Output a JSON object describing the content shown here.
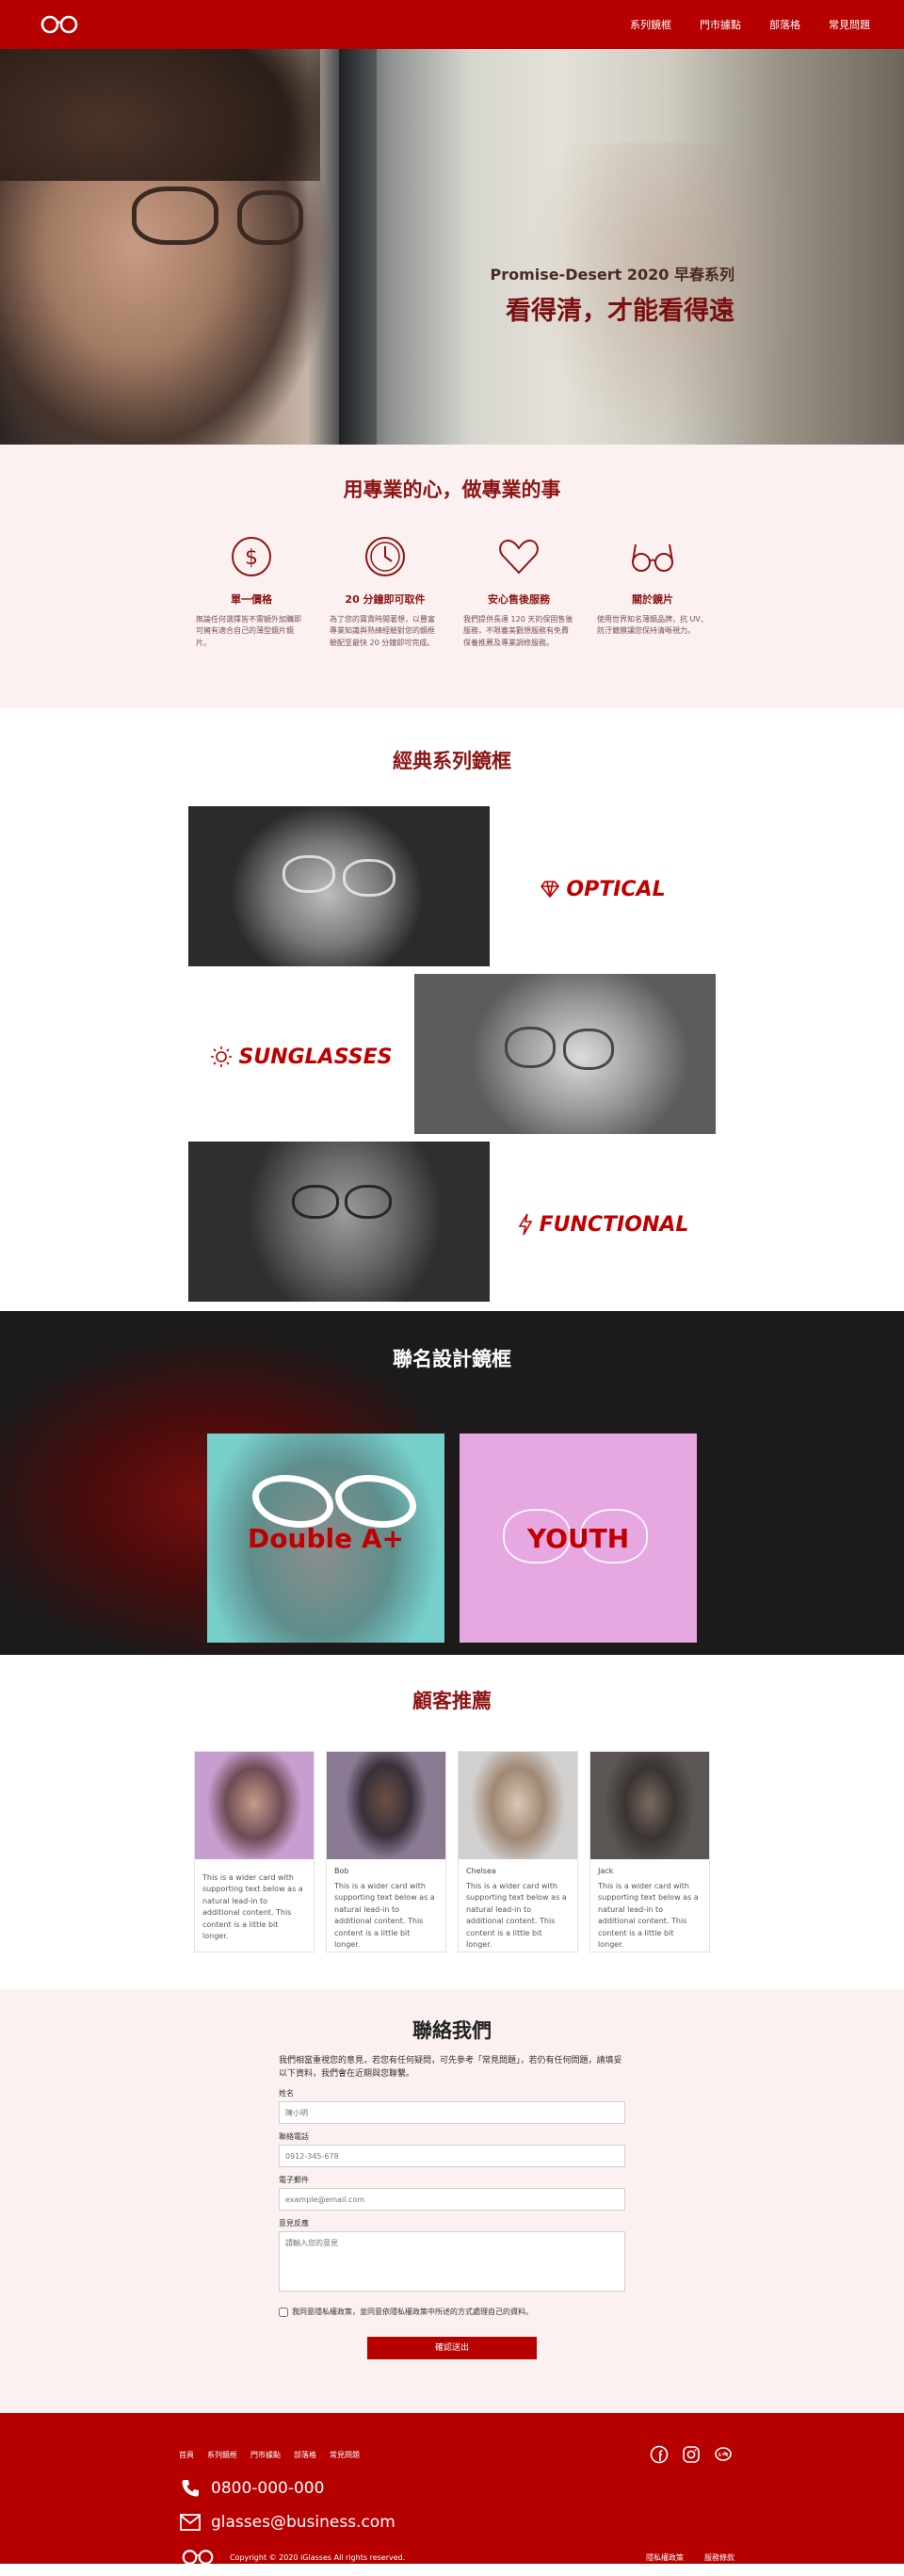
{
  "nav": {
    "links": [
      "系列鏡框",
      "門市據點",
      "部落格",
      "常見問題"
    ]
  },
  "hero": {
    "subtitle": "Promise-Desert 2020 早春系列",
    "title": "看得清，才能看得遠"
  },
  "about": {
    "title": "用專業的心，做專業的事",
    "features": [
      {
        "icon": "dollar-icon",
        "title": "單一價格",
        "text": "無論任何選擇皆不需額外加購即可擁有適合自己的薄型鏡片鏡片。"
      },
      {
        "icon": "clock-icon",
        "title": "20 分鐘即可取件",
        "text": "為了您的寶貴時間著想，以豐富專業知識與熟練經驗對您的鏡框驗配至最快 20 分鐘即可完成。"
      },
      {
        "icon": "heart-icon",
        "title": "安心售後服務",
        "text": "我們提供長達 120 天的保固售後服務，不限審美觀想服務有免費保養推薦及專業調修服務。"
      },
      {
        "icon": "glasses-icon",
        "title": "關於鏡片",
        "text": "使用世界知名薄鏡品牌，抗 UV、防汙鍍膜讓您保持清晰視力。"
      }
    ]
  },
  "classic": {
    "title": "經典系列鏡框",
    "series": [
      {
        "label": "OPTICAL",
        "icon": "diamond-icon"
      },
      {
        "label": "SUNGLASSES",
        "icon": "sun-icon"
      },
      {
        "label": "FUNCTIONAL",
        "icon": "bolt-icon"
      }
    ]
  },
  "collab": {
    "title": "聯名設計鏡框",
    "cards": [
      "Double A+",
      "YOUTH"
    ]
  },
  "testimonials": {
    "title": "顧客推薦",
    "cards": [
      {
        "name": "",
        "text": "This is a wider card with supporting text below as a natural lead-in to additional content. This content is a little bit longer."
      },
      {
        "name": "Bob",
        "text": "This is a wider card with supporting text below as a natural lead-in to additional content. This content is a little bit longer."
      },
      {
        "name": "Chelsea",
        "text": "This is a wider card with supporting text below as a natural lead-in to additional content. This content is a little bit longer."
      },
      {
        "name": "Jack",
        "text": "This is a wider card with supporting text below as a natural lead-in to additional content. This content is a little bit longer."
      }
    ]
  },
  "contact": {
    "title": "聯絡我們",
    "intro": "我們相當重視您的意見，若您有任何疑問，可先參考「常見問題」，若仍有任何問題，請填妥以下資料，我們會在近期與您聯繫。",
    "name_label": "姓名",
    "name_placeholder": "陳小明",
    "phone_label": "聯絡電話",
    "phone_placeholder": "0912-345-678",
    "email_label": "電子郵件",
    "email_placeholder": "example@email.com",
    "message_label": "意見反應",
    "message_placeholder": "請輸入您的意見",
    "consent": "我同意隱私權政策，並同意依隱私權政策中所述的方式處理自己的資料。",
    "submit": "確認送出"
  },
  "footer": {
    "nav": [
      "首頁",
      "系列鏡框",
      "門市據點",
      "部落格",
      "常見問題"
    ],
    "phone": "0800-000-000",
    "email": "glasses@business.com",
    "copyright": "Copyright © 2020 iGlasses All rights reserved.",
    "links": [
      "隱私權政策",
      "服務條款"
    ],
    "colors": {
      "brand": "#b70000",
      "accent": "#8c1515"
    }
  }
}
